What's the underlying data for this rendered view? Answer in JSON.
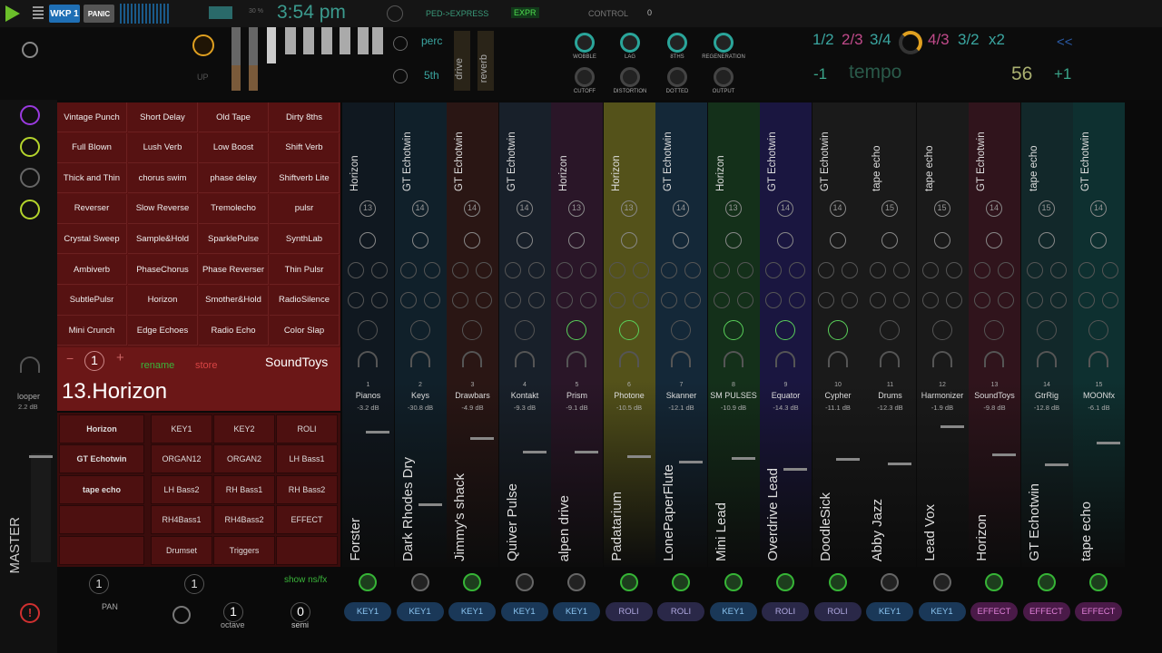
{
  "topbar": {
    "wkp": "WKP 1",
    "panic": "PANIC",
    "volume": "30 %",
    "clock": "3:54 pm",
    "ped": "PED->EXPRESS",
    "expr": "EXPR",
    "control_label": "CONTROL",
    "control_value": "0"
  },
  "controls": {
    "up": "UP",
    "perc": "perc",
    "fifth": "5th",
    "drive": "drive",
    "reverb": "reverb",
    "knobs": [
      "WOBBLE",
      "LAG",
      "8THS",
      "REGENERATION",
      "CUTOFF",
      "DISTORTION",
      "DOTTED",
      "OUTPUT"
    ]
  },
  "tempo": {
    "ratios": [
      "1/2",
      "2/3",
      "3/4",
      "4/3",
      "3/2",
      "x2"
    ],
    "prev": "<<",
    "minus": "-1",
    "label": "tempo",
    "value": "56",
    "plus": "+1"
  },
  "fx": [
    "Vintage Punch",
    "Short Delay",
    "Old Tape",
    "Dirty 8ths",
    "Full Blown",
    "Lush Verb",
    "Low Boost",
    "Shift Verb",
    "Thick and Thin",
    "chorus swim",
    "phase delay",
    "Shiftverb Lite",
    "Reverser",
    "Slow Reverse",
    "Tremolecho",
    "pulsr",
    "Crystal Sweep",
    "Sample&Hold",
    "SparklePulse",
    "SynthLab",
    "Ambiverb",
    "PhaseChorus",
    "Phase Reverser",
    "Thin Pulsr",
    "SubtlePulsr",
    "Horizon",
    "Smother&Hold",
    "RadioSilence",
    "Mini Crunch",
    "Edge Echoes",
    "Radio Echo",
    "Color Slap"
  ],
  "preset": {
    "minus": "−",
    "num": "1",
    "plus": "+",
    "rename": "rename",
    "store": "store",
    "brand": "SoundToys",
    "title": "13.Horizon"
  },
  "looper": {
    "label": "looper",
    "db": "2.2 dB"
  },
  "inserts": [
    "Horizon",
    "GT Echotwin",
    "tape echo"
  ],
  "keys": [
    "KEY1",
    "KEY2",
    "ROLI",
    "ORGAN12",
    "ORGAN2",
    "LH Bass1",
    "LH Bass2",
    "RH Bass1",
    "RH Bass2",
    "RH4Bass1",
    "RH4Bass2",
    "EFFECT",
    "Drumset",
    "Triggers",
    ""
  ],
  "master": "MASTER",
  "bottom": {
    "num1": "1",
    "num2": "1",
    "showns": "show ns/fx",
    "pan": "PAN",
    "octave_val": "1",
    "octave": "octave",
    "semi_val": "0",
    "semi": "semi"
  },
  "channels": [
    {
      "top": "Horizon",
      "n": "13",
      "num": "1",
      "label": "Pianos",
      "db": "-3.2 dB",
      "bot": "Forster",
      "pill": "KEY1"
    },
    {
      "top": "GT Echotwin",
      "n": "14",
      "num": "2",
      "label": "Keys",
      "db": "-30.8 dB",
      "bot": "Dark Rhodes Dry",
      "pill": "KEY1"
    },
    {
      "top": "GT Echotwin",
      "n": "14",
      "num": "3",
      "label": "Drawbars",
      "db": "-4.9 dB",
      "bot": "Jimmy's shack",
      "pill": "KEY1"
    },
    {
      "top": "GT Echotwin",
      "n": "14",
      "num": "4",
      "label": "Kontakt",
      "db": "-9.3 dB",
      "bot": "Quiver Pulse",
      "pill": "KEY1"
    },
    {
      "top": "Horizon",
      "n": "13",
      "num": "5",
      "label": "Prism",
      "db": "-9.1 dB",
      "bot": "alpen drive",
      "pill": "KEY1"
    },
    {
      "top": "Horizon",
      "n": "13",
      "num": "6",
      "label": "Photone",
      "db": "-10.5 dB",
      "bot": "Padatarium",
      "pill": "ROLI"
    },
    {
      "top": "GT Echotwin",
      "n": "14",
      "num": "7",
      "label": "Skanner",
      "db": "-12.1 dB",
      "bot": "LonePaperFlute",
      "pill": "ROLI"
    },
    {
      "top": "Horizon",
      "n": "13",
      "num": "8",
      "label": "SM PULSES",
      "db": "-10.9 dB",
      "bot": "Mini Lead",
      "pill": "KEY1"
    },
    {
      "top": "GT Echotwin",
      "n": "14",
      "num": "9",
      "label": "Equator",
      "db": "-14.3 dB",
      "bot": "Overdrive Lead",
      "pill": "ROLI"
    },
    {
      "top": "GT Echotwin",
      "n": "14",
      "num": "10",
      "label": "Cypher",
      "db": "-11.1 dB",
      "bot": "DoodleSick",
      "pill": "ROLI"
    },
    {
      "top": "tape echo",
      "n": "15",
      "num": "11",
      "label": "Drums",
      "db": "-12.3 dB",
      "bot": "Abby Jazz",
      "pill": "KEY1"
    },
    {
      "top": "tape echo",
      "n": "15",
      "num": "12",
      "label": "Harmonizer",
      "db": "-1.9 dB",
      "bot": "Lead Vox",
      "pill": "KEY1"
    },
    {
      "top": "GT Echotwin",
      "n": "14",
      "num": "13",
      "label": "SoundToys",
      "db": "-9.8 dB",
      "bot": "Horizon",
      "pill": "EFFECT"
    },
    {
      "top": "tape echo",
      "n": "15",
      "num": "14",
      "label": "GtrRig",
      "db": "-12.8 dB",
      "bot": "GT Echotwin",
      "pill": "EFFECT"
    },
    {
      "top": "GT Echotwin",
      "n": "14",
      "num": "15",
      "label": "MOONfx",
      "db": "-6.1 dB",
      "bot": "tape echo",
      "pill": "EFFECT"
    }
  ],
  "colors": {
    "accent": "#2aa59a",
    "fx_red": "#561212",
    "lime": "#b4d42c",
    "green": "#36b536"
  }
}
